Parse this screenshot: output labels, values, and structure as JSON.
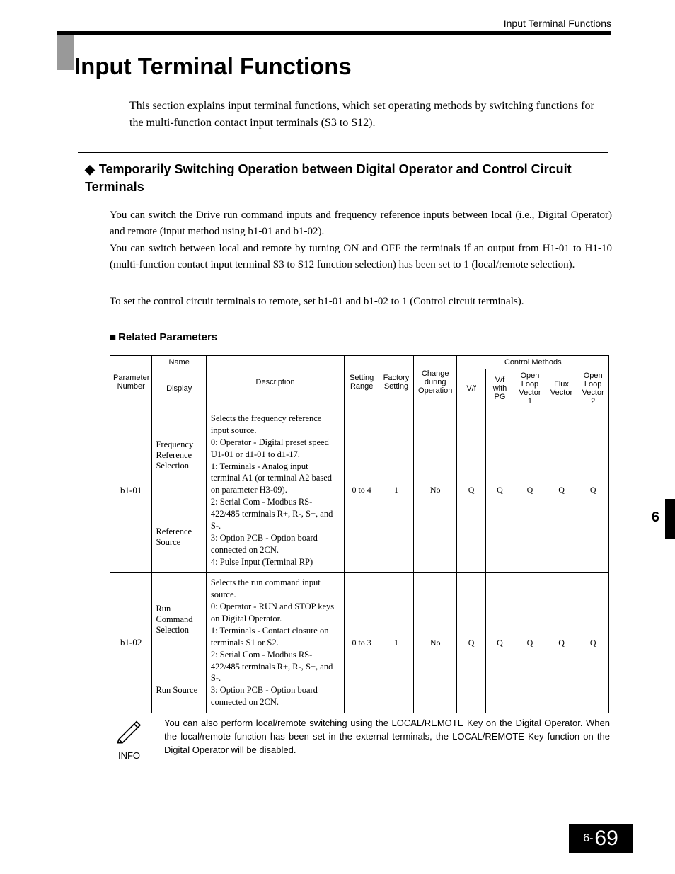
{
  "header_label": "Input Terminal Functions",
  "main_title": "Input Terminal Functions",
  "intro": "This section explains input terminal functions, which set operating methods by switching functions for the multi-function contact input terminals (S3 to S12).",
  "subheading": "Temporarily Switching Operation between Digital Operator and Control Circuit Terminals",
  "para1": "You can switch the Drive run command inputs and frequency reference inputs between local (i.e., Digital Operator) and remote (input method using b1-01 and b1-02).",
  "para2": "You can switch between local and remote by turning ON and OFF the terminals if an output from H1-01 to H1-10 (multi-function contact input terminal S3 to S12 function selection) has been set to 1 (local/remote selection).",
  "para3": "To set the control circuit terminals to remote, set b1-01 and b1-02 to 1 (Control circuit terminals).",
  "related_heading": "Related Parameters",
  "table": {
    "headers": {
      "param": "Parameter Number",
      "name": "Name",
      "display": "Display",
      "desc": "Description",
      "srange": "Setting Range",
      "fset": "Factory Setting",
      "change": "Change during Operation",
      "cm_group": "Control Methods",
      "cm1": "V/f",
      "cm2": "V/f with PG",
      "cm3": "Open Loop Vector 1",
      "cm4": "Flux Vector",
      "cm5": "Open Loop Vector 2"
    },
    "rows": [
      {
        "param": "b1-01",
        "name": "Frequency Reference Selection",
        "display": "Reference Source",
        "desc": "Selects the frequency reference input source.\n0: Operator - Digital preset speed U1-01 or d1-01 to d1-17.\n1: Terminals - Analog input terminal A1 (or terminal A2 based on parameter H3-09).\n2: Serial Com - Modbus RS-422/485 terminals R+, R-, S+, and S-.\n3: Option PCB - Option board connected on 2CN.\n4: Pulse Input (Terminal RP)",
        "srange": "0 to 4",
        "fset": "1",
        "change": "No",
        "cm": [
          "Q",
          "Q",
          "Q",
          "Q",
          "Q"
        ]
      },
      {
        "param": "b1-02",
        "name": "Run Command Selection",
        "display": "Run Source",
        "desc": "Selects the run command input source.\n0: Operator - RUN and STOP keys on Digital Operator.\n1: Terminals - Contact closure on terminals S1 or S2.\n2: Serial Com - Modbus RS-422/485 terminals R+, R-, S+, and S-.\n3: Option PCB - Option board connected on 2CN.",
        "srange": "0 to 3",
        "fset": "1",
        "change": "No",
        "cm": [
          "Q",
          "Q",
          "Q",
          "Q",
          "Q"
        ]
      }
    ]
  },
  "note": {
    "label": "INFO",
    "text": "You can also perform local/remote switching using the LOCAL/REMOTE Key on the Digital Operator. When the local/remote function has been set in the external terminals, the LOCAL/REMOTE Key function on the Digital Operator will be disabled."
  },
  "side_chapter": "6",
  "page_prefix": "6-",
  "page_number": "69"
}
